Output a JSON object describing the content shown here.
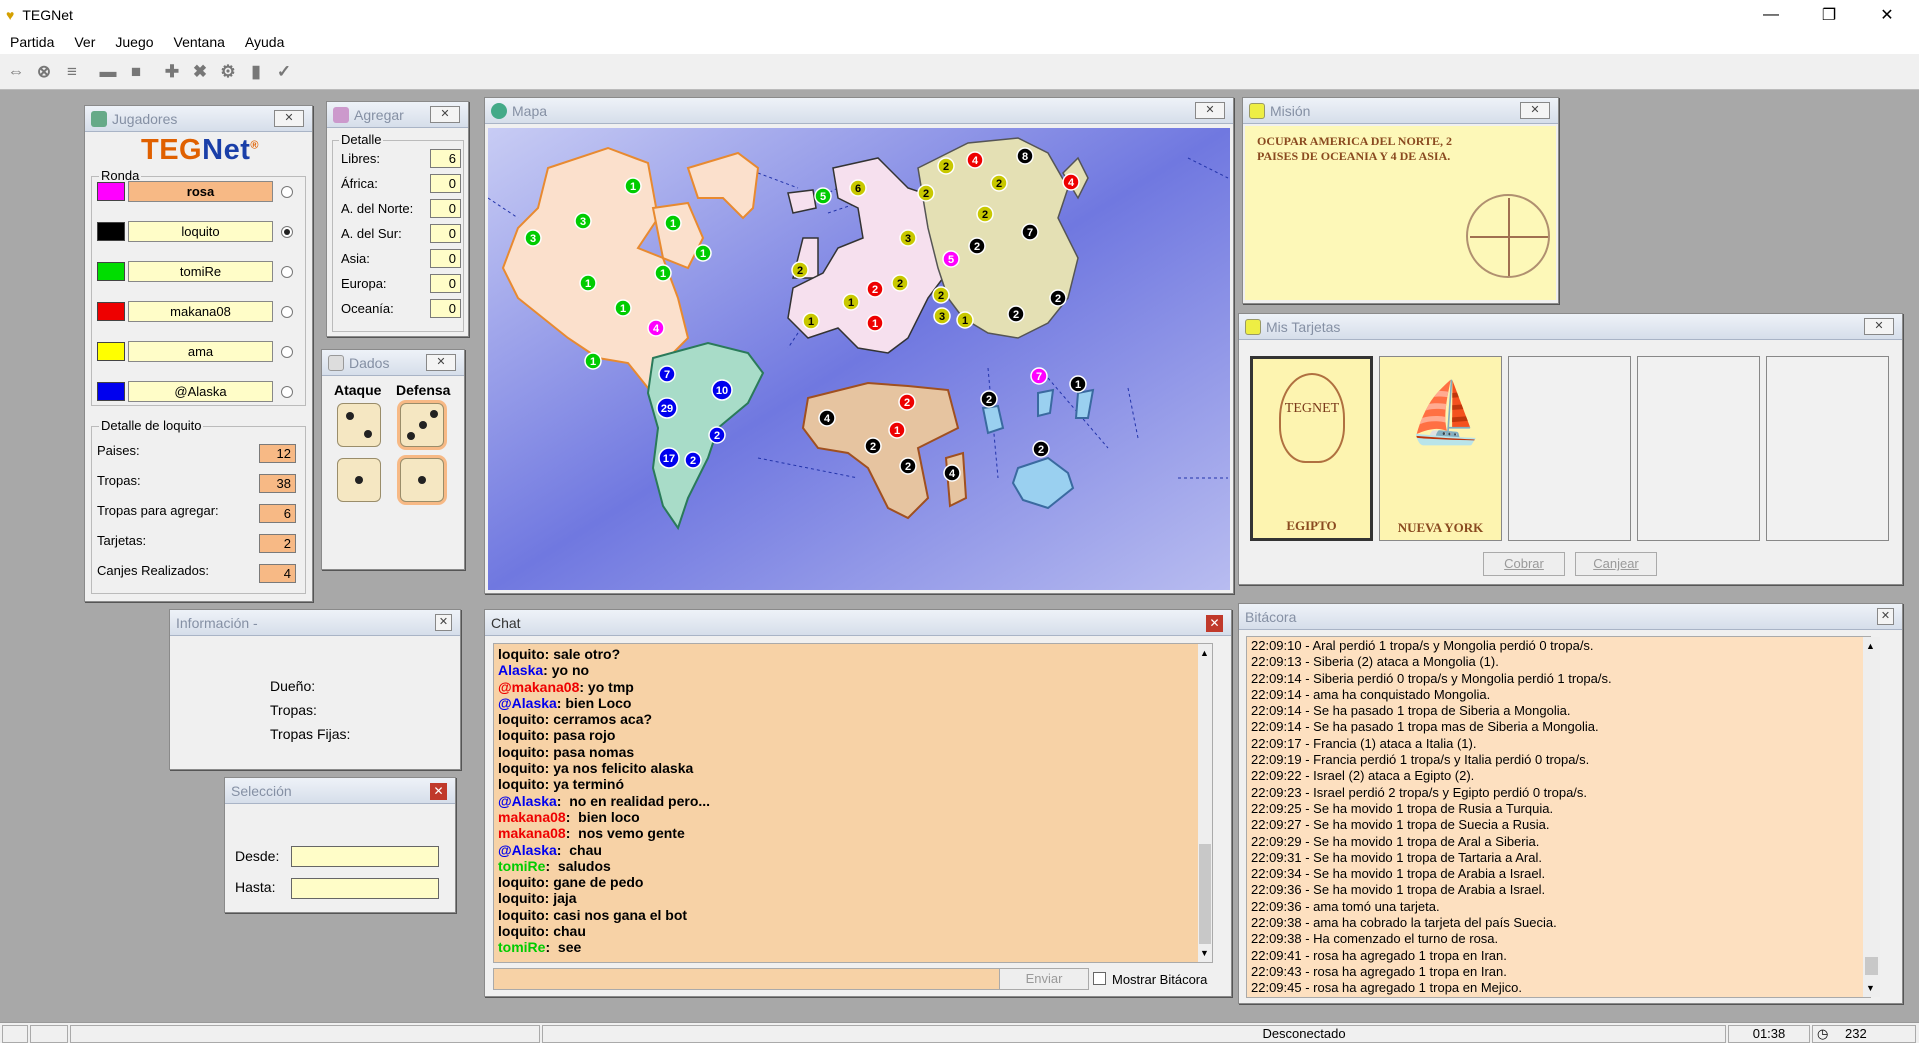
{
  "app": {
    "title": "TEGNet"
  },
  "menu": [
    "Partida",
    "Ver",
    "Juego",
    "Ventana",
    "Ayuda"
  ],
  "jugadores": {
    "title": "Jugadores",
    "logo": "TEGNet",
    "round_label": "Ronda",
    "players": [
      {
        "name": "rosa",
        "color": "#ff00ff",
        "active": false
      },
      {
        "name": "loquito",
        "color": "#000000",
        "active": true
      },
      {
        "name": "tomiRe",
        "color": "#00dd00",
        "active": false
      },
      {
        "name": "makana08",
        "color": "#ee0000",
        "active": false
      },
      {
        "name": "ama",
        "color": "#ffff00",
        "active": false
      },
      {
        "name": "@Alaska",
        "color": "#0000ee",
        "active": false
      }
    ],
    "detail_title": "Detalle de loquito",
    "details": [
      {
        "label": "Paises:",
        "value": "12"
      },
      {
        "label": "Tropas:",
        "value": "38"
      },
      {
        "label": "Tropas para agregar:",
        "value": "6"
      },
      {
        "label": "Tarjetas:",
        "value": "2"
      },
      {
        "label": "Canjes Realizados:",
        "value": "4"
      }
    ]
  },
  "agregar": {
    "title": "Agregar",
    "group": "Detalle",
    "rows": [
      {
        "label": "Libres:",
        "value": "6"
      },
      {
        "label": "África:",
        "value": "0"
      },
      {
        "label": "A. del Norte:",
        "value": "0"
      },
      {
        "label": "A. del Sur:",
        "value": "0"
      },
      {
        "label": "Asia:",
        "value": "0"
      },
      {
        "label": "Europa:",
        "value": "0"
      },
      {
        "label": "Oceanía:",
        "value": "0"
      }
    ]
  },
  "dados": {
    "title": "Dados",
    "attack": "Ataque",
    "defense": "Defensa"
  },
  "mapa": {
    "title": "Mapa"
  },
  "mision": {
    "title": "Misión",
    "text": "OCUPAR AMERICA DEL NORTE, 2 PAISES DE OCEANIA Y 4 DE ASIA."
  },
  "tarjetas": {
    "title": "Mis Tarjetas",
    "cards": [
      "EGIPTO",
      "NUEVA YORK"
    ],
    "cobrar": "Cobrar",
    "canjear": "Canjear"
  },
  "info": {
    "title": "Información -",
    "labels": [
      "Dueño:",
      "Tropas:",
      "Tropas Fijas:"
    ]
  },
  "seleccion": {
    "title": "Selección",
    "desde": "Desde:",
    "hasta": "Hasta:"
  },
  "chat": {
    "title": "Chat",
    "enviar": "Enviar",
    "mostrar": "Mostrar Bitácora",
    "lines": [
      {
        "u": "loquito",
        "c": "#000000",
        "m": " sale otro?"
      },
      {
        "u": "Alaska",
        "c": "#0000ee",
        "m": " yo no"
      },
      {
        "u": "@makana08",
        "c": "#ee0000",
        "m": " yo tmp"
      },
      {
        "u": "@Alaska",
        "c": "#0000ee",
        "m": " bien Loco"
      },
      {
        "u": "loquito",
        "c": "#000000",
        "m": " cerramos aca?"
      },
      {
        "u": "loquito",
        "c": "#000000",
        "m": " pasa rojo"
      },
      {
        "u": "loquito",
        "c": "#000000",
        "m": " pasa nomas"
      },
      {
        "u": "loquito",
        "c": "#000000",
        "m": " ya nos felicito alaska"
      },
      {
        "u": "loquito",
        "c": "#000000",
        "m": " ya terminó"
      },
      {
        "u": "@Alaska",
        "c": "#0000ee",
        "m": "  no en realidad pero..."
      },
      {
        "u": "makana08",
        "c": "#ee0000",
        "m": "  bien loco"
      },
      {
        "u": "makana08",
        "c": "#ee0000",
        "m": "  nos vemo gente"
      },
      {
        "u": "@Alaska",
        "c": "#0000ee",
        "m": "  chau"
      },
      {
        "u": "tomiRe",
        "c": "#00cc00",
        "m": "  saludos"
      },
      {
        "u": "loquito",
        "c": "#000000",
        "m": " gane de pedo"
      },
      {
        "u": "loquito",
        "c": "#000000",
        "m": " jaja"
      },
      {
        "u": "loquito",
        "c": "#000000",
        "m": " casi nos gana el bot"
      },
      {
        "u": "loquito",
        "c": "#000000",
        "m": " chau"
      },
      {
        "u": "tomiRe",
        "c": "#00cc00",
        "m": "  see"
      }
    ]
  },
  "bitacora": {
    "title": "Bitácora",
    "lines": [
      "22:09:10 - Aral perdió 1 tropa/s y Mongolia perdió 0 tropa/s.",
      "22:09:13 - Siberia (2) ataca a Mongolia (1).",
      "22:09:14 - Siberia perdió 0 tropa/s y Mongolia perdió 1 tropa/s.",
      "22:09:14 - ama ha conquistado Mongolia.",
      "22:09:14 - Se ha pasado 1 tropa de Siberia a Mongolia.",
      "22:09:14 - Se ha pasado 1 tropa mas de Siberia a Mongolia.",
      "22:09:17 - Francia (1) ataca a Italia (1).",
      "22:09:19 - Francia perdió 1 tropa/s y Italia perdió 0 tropa/s.",
      "22:09:22 - Israel (2) ataca a Egipto (2).",
      "22:09:23 - Israel perdió 2 tropa/s y Egipto perdió 0 tropa/s.",
      "22:09:25 - Se ha movido 1 tropa de Rusia a Turquia.",
      "22:09:27 - Se ha movido 1 tropa de Suecia a Rusia.",
      "22:09:29 - Se ha movido 1 tropa de Aral a Siberia.",
      "22:09:31 - Se ha movido 1 tropa de Tartaria a Aral.",
      "22:09:34 - Se ha movido 1 tropa de Arabia a Israel.",
      "22:09:36 - Se ha movido 1 tropa de Arabia a Israel.",
      "22:09:36 - ama tomó una tarjeta.",
      "22:09:38 - ama ha cobrado la tarjeta del país Suecia.",
      "22:09:38 - Ha comenzado el turno de rosa.",
      "22:09:41 - rosa ha agregado 1 tropa en Iran.",
      "22:09:43 - rosa ha agregado 1 tropa en Iran.",
      "22:09:45 - rosa ha agregado 1 tropa en Mejico."
    ]
  },
  "status": {
    "conn": "Desconectado",
    "time": "01:38",
    "count": "232"
  },
  "colors": {
    "rosa": "#ff00ff",
    "black": "#000000",
    "green": "#00cc00",
    "red": "#ee0000",
    "yellow": "#c8c800",
    "blue": "#0000ee"
  },
  "armies": [
    {
      "n": "1",
      "c": "green"
    },
    {
      "n": "3",
      "c": "green"
    },
    {
      "n": "3",
      "c": "green"
    },
    {
      "n": "1",
      "c": "green"
    },
    {
      "n": "1",
      "c": "green"
    },
    {
      "n": "1",
      "c": "green"
    },
    {
      "n": "1",
      "c": "green"
    },
    {
      "n": "1",
      "c": "green"
    },
    {
      "n": "1",
      "c": "green"
    },
    {
      "n": "5",
      "c": "green"
    },
    {
      "n": "4",
      "c": "rosa"
    },
    {
      "n": "6",
      "c": "yellow"
    },
    {
      "n": "2",
      "c": "yellow"
    },
    {
      "n": "3",
      "c": "yellow"
    },
    {
      "n": "1",
      "c": "yellow"
    },
    {
      "n": "1",
      "c": "yellow"
    },
    {
      "n": "2",
      "c": "yellow"
    },
    {
      "n": "2",
      "c": "red"
    },
    {
      "n": "1",
      "c": "red"
    },
    {
      "n": "5",
      "c": "rosa"
    },
    {
      "n": "2",
      "c": "yellow"
    },
    {
      "n": "4",
      "c": "red"
    },
    {
      "n": "2",
      "c": "yellow"
    },
    {
      "n": "2",
      "c": "yellow"
    },
    {
      "n": "2",
      "c": "yellow"
    },
    {
      "n": "8",
      "c": "black"
    },
    {
      "n": "4",
      "c": "red"
    },
    {
      "n": "2",
      "c": "black"
    },
    {
      "n": "7",
      "c": "black"
    },
    {
      "n": "2",
      "c": "yellow"
    },
    {
      "n": "3",
      "c": "yellow"
    },
    {
      "n": "1",
      "c": "yellow"
    },
    {
      "n": "2",
      "c": "black"
    },
    {
      "n": "2",
      "c": "black"
    },
    {
      "n": "7",
      "c": "blue"
    },
    {
      "n": "10",
      "c": "blue"
    },
    {
      "n": "29",
      "c": "blue"
    },
    {
      "n": "2",
      "c": "blue"
    },
    {
      "n": "17",
      "c": "blue"
    },
    {
      "n": "2",
      "c": "blue"
    },
    {
      "n": "4",
      "c": "black"
    },
    {
      "n": "2",
      "c": "red"
    },
    {
      "n": "1",
      "c": "red"
    },
    {
      "n": "2",
      "c": "black"
    },
    {
      "n": "2",
      "c": "black"
    },
    {
      "n": "4",
      "c": "black"
    },
    {
      "n": "2",
      "c": "black"
    },
    {
      "n": "7",
      "c": "rosa"
    },
    {
      "n": "1",
      "c": "black"
    },
    {
      "n": "2",
      "c": "black"
    }
  ]
}
